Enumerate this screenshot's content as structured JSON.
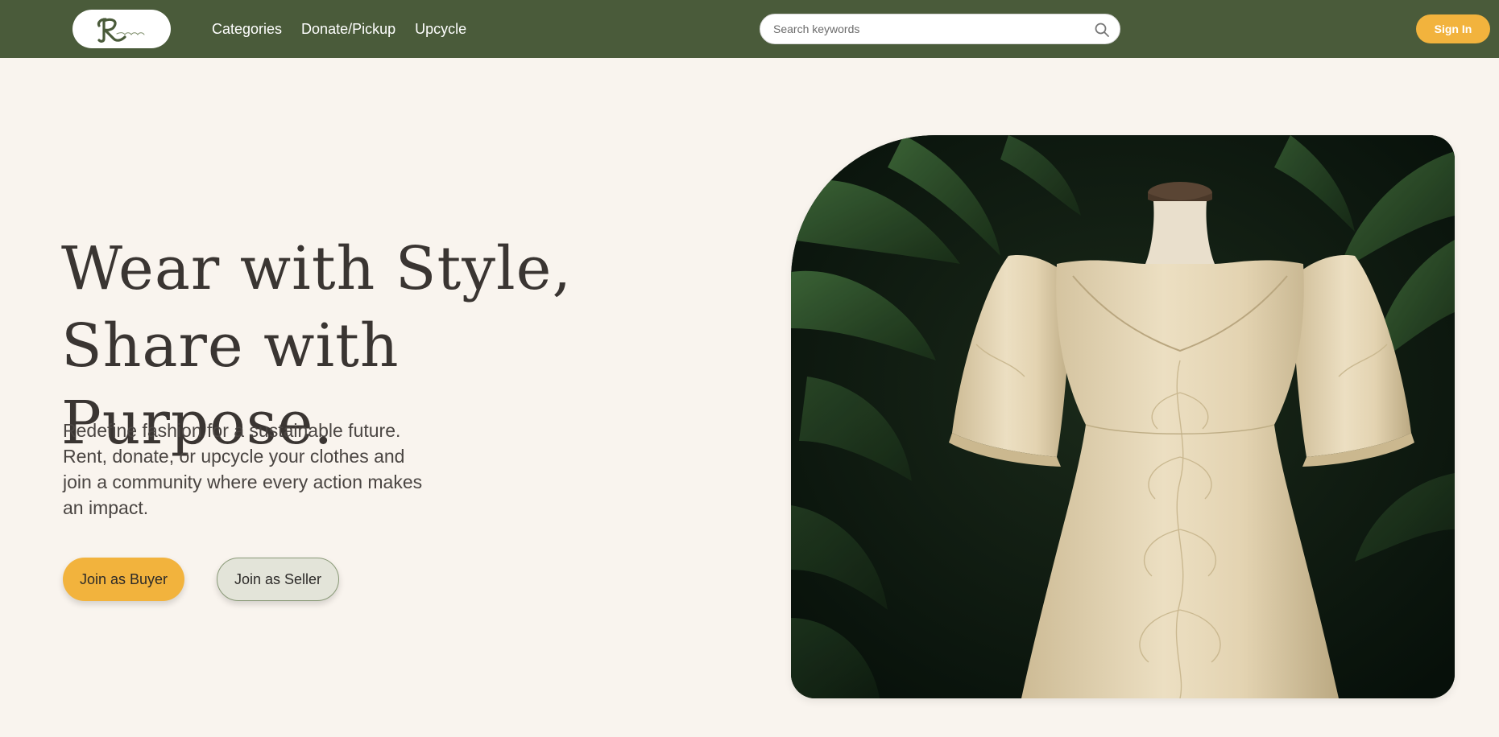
{
  "nav": {
    "links": [
      "Categories",
      "Donate/Pickup",
      "Upcycle"
    ],
    "search_placeholder": "Search keywords",
    "sign_in_label": "Sign In"
  },
  "hero": {
    "title_line1": "Wear with Style,",
    "title_line2": "Share with Purpose.",
    "subtitle": "Redefine fashion for a sustainable future. Rent, donate, or upcycle your clothes and join a community where every action makes an impact.",
    "buyer_label": "Join as Buyer",
    "seller_label": "Join as Seller"
  },
  "colors": {
    "nav_bg": "#4a5b3a",
    "page_bg": "#f9f4ee",
    "accent": "#f2b33d",
    "seller_bg": "#e3e4d9"
  },
  "icons": {
    "logo": "logo-mark",
    "search": "search-icon"
  }
}
